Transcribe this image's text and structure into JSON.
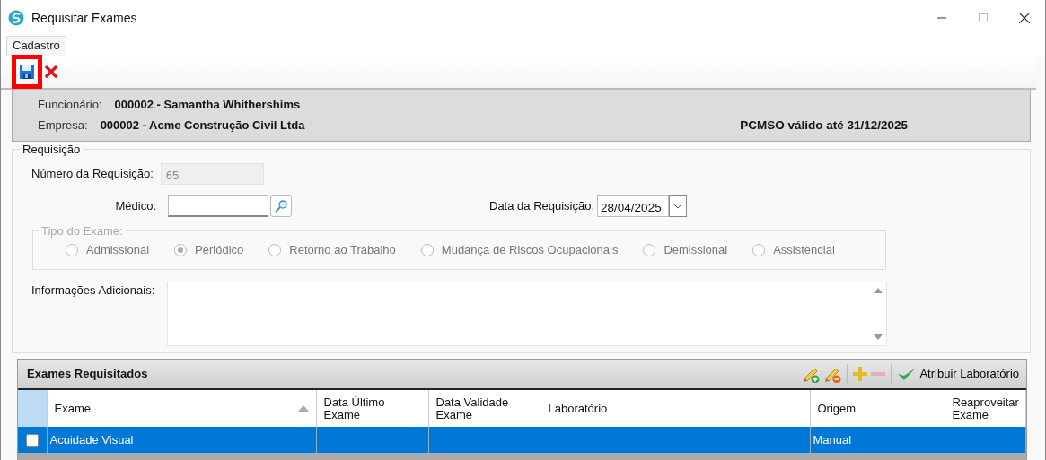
{
  "window": {
    "title": "Requisitar Exames"
  },
  "tabs": [
    {
      "label": "Cadastro",
      "selected": true
    }
  ],
  "toolbar": {
    "buttons": [
      {
        "kind": "save",
        "highlighted": true
      },
      {
        "kind": "cancel",
        "highlighted": false
      }
    ]
  },
  "header": {
    "employee_label": "Funcionário:",
    "employee": "000002 - Samantha Whithershims",
    "company_label": "Empresa:",
    "company": "000002 - Acme Construção Civil Ltda",
    "pcmso": "PCMSO válido até 31/12/2025"
  },
  "requisition": {
    "legend": "Requisição",
    "number_label": "Número da Requisição:",
    "number": "65",
    "doctor_label": "Médico:",
    "date_label": "Data da Requisição:",
    "date": "28/04/2025",
    "exam_type": {
      "legend": "Tipo do Exame:",
      "disabled": true,
      "options": [
        {
          "label": "Admissional",
          "selected": false
        },
        {
          "label": "Periódico",
          "selected": true
        },
        {
          "label": "Retorno ao Trabalho",
          "selected": false
        },
        {
          "label": "Mudança de Riscos Ocupacionais",
          "selected": false
        },
        {
          "label": "Demissional",
          "selected": false
        },
        {
          "label": "Assistencial",
          "selected": false
        }
      ]
    },
    "notes_label": "Informações Adicionais:"
  },
  "exams": {
    "title": "Exames Requisitados",
    "tools": [
      {
        "kind": "pencil-add",
        "disabled": false
      },
      {
        "kind": "pencil-remove",
        "disabled": false
      },
      {
        "kind": "add",
        "disabled": false
      },
      {
        "kind": "remove",
        "disabled": true
      }
    ],
    "assign_label": "Atribuir Laboratório",
    "columns": [
      {
        "label": "Exame",
        "sorted": true
      },
      {
        "label": "Data Último Exame",
        "sorted": false
      },
      {
        "label": "Data Validade Exame",
        "sorted": false
      },
      {
        "label": "Laboratório",
        "sorted": false
      },
      {
        "label": "Origem",
        "sorted": false
      },
      {
        "label": "Reaproveitar Exame",
        "sorted": false
      }
    ],
    "rows": [
      {
        "checked": false,
        "selected": true,
        "cells": {
          "0": "Acuidade Visual",
          "4": "Manual"
        }
      }
    ]
  }
}
